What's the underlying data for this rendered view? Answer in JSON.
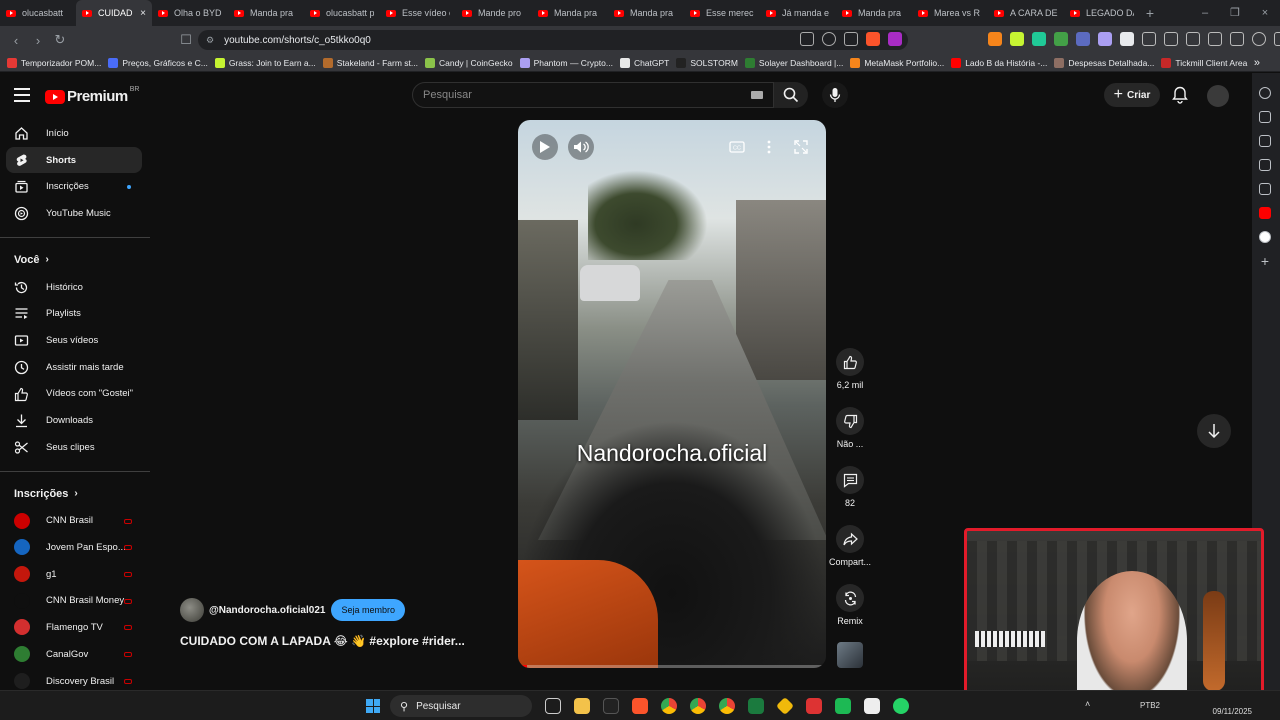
{
  "browser": {
    "tabs": [
      {
        "label": "olucasbatt"
      },
      {
        "label": "CUIDAD",
        "active": true
      },
      {
        "label": "Olha o BYD"
      },
      {
        "label": "Manda pra"
      },
      {
        "label": "olucasbatt p"
      },
      {
        "label": "Esse vídeo é"
      },
      {
        "label": "Mande pro"
      },
      {
        "label": "Manda pra"
      },
      {
        "label": "Manda pra"
      },
      {
        "label": "Esse merec"
      },
      {
        "label": "Já manda e"
      },
      {
        "label": "Manda pra"
      },
      {
        "label": "Marea vs R"
      },
      {
        "label": "A CARA DE"
      },
      {
        "label": "LEGADO DA"
      }
    ],
    "new_tab_glyph": "+",
    "url": "youtube.com/shorts/c_o5tkko0q0",
    "bookmarks": [
      {
        "label": "Temporizador POM...",
        "color": "#e53935"
      },
      {
        "label": "Preços, Gráficos e C...",
        "color": "#4a6cf7"
      },
      {
        "label": "Grass: Join to Earn a...",
        "color": "#c6f432"
      },
      {
        "label": "Stakeland - Farm st...",
        "color": "#b36b2c"
      },
      {
        "label": "Candy | CoinGecko",
        "color": "#8bc34a"
      },
      {
        "label": "Phantom — Crypto...",
        "color": "#ab9ff2"
      },
      {
        "label": "ChatGPT",
        "color": "#e8e8e8"
      },
      {
        "label": "SOLSTORM",
        "color": "#222222"
      },
      {
        "label": "Solayer Dashboard |...",
        "color": "#2e7d32"
      },
      {
        "label": "MetaMask Portfolio...",
        "color": "#f6851b"
      },
      {
        "label": "Lado B da História -...",
        "color": "#ff0000"
      },
      {
        "label": "Despesas Detalhada...",
        "color": "#8d6e63"
      },
      {
        "label": "Tickmill Client Area",
        "color": "#c62828"
      }
    ]
  },
  "header": {
    "logo_text": "Premium",
    "logo_region": "BR",
    "search_placeholder": "Pesquisar",
    "create_label": "Criar"
  },
  "sidebar": {
    "main": [
      {
        "label": "Início",
        "icon": "home-icon"
      },
      {
        "label": "Shorts",
        "icon": "shorts-icon",
        "active": true
      },
      {
        "label": "Inscrições",
        "icon": "subscriptions-icon",
        "dot": true
      },
      {
        "label": "YouTube Music",
        "icon": "music-icon"
      }
    ],
    "you_title": "Você",
    "you": [
      {
        "label": "Histórico",
        "icon": "history-icon"
      },
      {
        "label": "Playlists",
        "icon": "playlists-icon"
      },
      {
        "label": "Seus vídeos",
        "icon": "your-videos-icon"
      },
      {
        "label": "Assistir mais tarde",
        "icon": "watch-later-icon"
      },
      {
        "label": "Vídeos com \"Gostei\"",
        "icon": "liked-icon"
      },
      {
        "label": "Downloads",
        "icon": "download-icon"
      },
      {
        "label": "Seus clipes",
        "icon": "clips-icon"
      }
    ],
    "subs_title": "Inscrições",
    "subs": [
      {
        "label": "CNN Brasil",
        "color": "#cc0000"
      },
      {
        "label": "Jovem Pan Espo...",
        "color": "#1565c0"
      },
      {
        "label": "g1",
        "color": "#c4170c"
      },
      {
        "label": "CNN Brasil Money",
        "color": "#0f0f0f"
      },
      {
        "label": "Flamengo TV",
        "color": "#d32f2f"
      },
      {
        "label": "CanalGov",
        "color": "#2e7d32"
      },
      {
        "label": "Discovery Brasil",
        "color": "#1e1e1e"
      }
    ]
  },
  "video": {
    "watermark": "Nandorocha.oficial",
    "progress": 0.03
  },
  "actions": {
    "like_count": "6,2 mil",
    "dislike_label": "Não ...",
    "comments_count": "82",
    "share_label": "Compart...",
    "remix_label": "Remix"
  },
  "meta": {
    "channel": "@Nandorocha.oficial021",
    "member_button": "Seja membro",
    "caption": "CUIDADO COM A LAPADA 😂 👋 #explore #rider..."
  },
  "taskbar": {
    "search_label": "Pesquisar",
    "lang": "PTB2",
    "date": "09/11/2025"
  },
  "colors": {
    "accent_red": "#ff0000",
    "member_blue": "#3ea6ff",
    "webcam_border": "#e21b2a"
  }
}
